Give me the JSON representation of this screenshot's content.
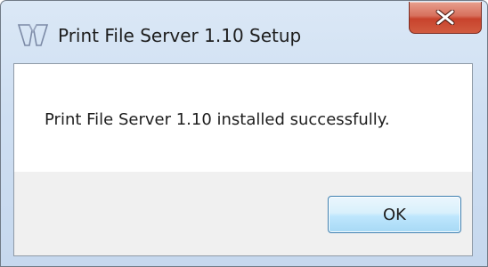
{
  "window": {
    "title": "Print File Server 1.10 Setup",
    "title_icon": "installer-icon",
    "close_icon": "close-icon"
  },
  "dialog": {
    "message": "Print File Server 1.10 installed successfully.",
    "ok_label": "OK"
  },
  "colors": {
    "frame": "#cfdff2",
    "close_button": "#c8432c",
    "content_background": "#ffffff",
    "button_area": "#f0f0f0",
    "ok_button_border": "#3c7fb1"
  }
}
